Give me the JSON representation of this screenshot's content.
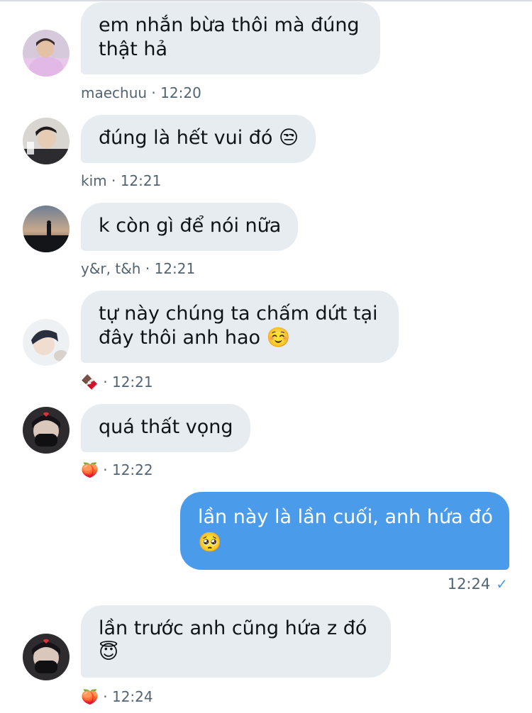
{
  "messages": [
    {
      "text": "em nhắn bừa thôi mà đúng thật hả",
      "sender": "maechuu",
      "time": "12:20"
    },
    {
      "text": "đúng là hết vui đó",
      "emoji": "😒",
      "sender": "kim",
      "time": "12:21"
    },
    {
      "text": "k còn gì để nói nữa",
      "sender": "y&r, t&h",
      "time": "12:21"
    },
    {
      "text": "tự này chúng ta chấm dứt tại đây thôi anh hao",
      "emoji": "☺️",
      "sender_emoji": "🍫",
      "time": "12:21"
    },
    {
      "text": "quá thất vọng",
      "sender_emoji": "🍑",
      "time": "12:22"
    },
    {
      "text": "lần trước anh cũng hứa z đó",
      "emoji": "😇",
      "sender_emoji": "🍑",
      "time": "12:24"
    }
  ],
  "outgoing": {
    "text": "lần này là lần cuối, anh hứa đó",
    "emoji": "🥺",
    "time": "12:24",
    "check": "✓"
  },
  "separator": " · ",
  "colors": {
    "incoming_bubble": "#e7ecf0",
    "outgoing_bubble": "#4a9be9",
    "meta_text": "#536471",
    "check": "#4a9be9"
  }
}
